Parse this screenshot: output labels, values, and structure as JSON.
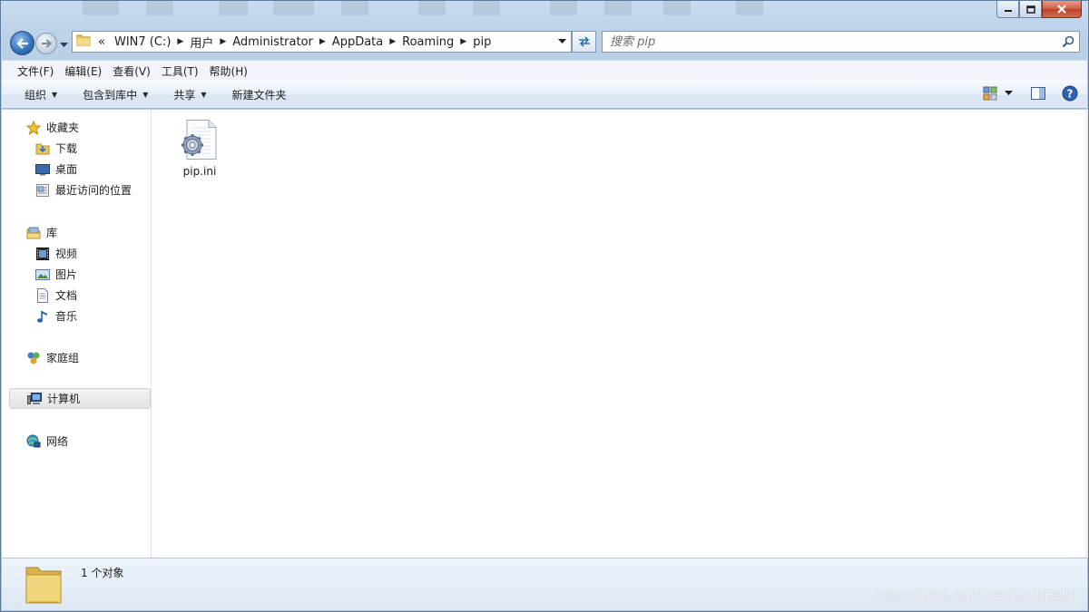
{
  "window": {
    "caption_buttons": [
      "minimize",
      "maximize",
      "close"
    ]
  },
  "address_bar": {
    "overflow_glyph": "«",
    "crumbs": [
      "WIN7 (C:)",
      "用户",
      "Administrator",
      "AppData",
      "Roaming",
      "pip"
    ]
  },
  "search": {
    "placeholder": "搜索 pip"
  },
  "menubar": {
    "items": [
      "文件(F)",
      "编辑(E)",
      "查看(V)",
      "工具(T)",
      "帮助(H)"
    ]
  },
  "commandbar": {
    "organize": "组织",
    "include_in_library": "包含到库中",
    "share": "共享",
    "new_folder": "新建文件夹"
  },
  "navpane": {
    "favorites": {
      "label": "收藏夹",
      "items": [
        "下载",
        "桌面",
        "最近访问的位置"
      ]
    },
    "libraries": {
      "label": "库",
      "items": [
        "视频",
        "图片",
        "文档",
        "音乐"
      ]
    },
    "homegroup": {
      "label": "家庭组"
    },
    "computer": {
      "label": "计算机"
    },
    "network": {
      "label": "网络"
    }
  },
  "content": {
    "files": [
      {
        "name": "pip.ini",
        "icon": "config-file-icon"
      }
    ]
  },
  "details": {
    "count_text": "1 个对象"
  },
  "watermark": "https://blog.csdn.net/BcXbHello"
}
